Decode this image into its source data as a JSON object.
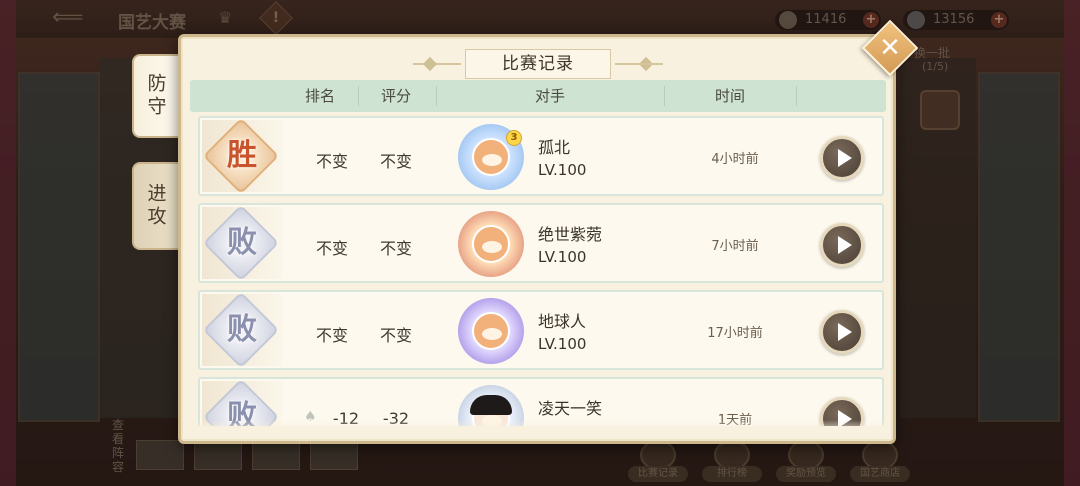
{
  "background": {
    "title": "国艺大赛",
    "resources": [
      {
        "value": "11416",
        "icon": "flower-icon"
      },
      {
        "value": "13156",
        "icon": "coin-icon"
      }
    ],
    "hint_text": "换一批",
    "hint_sub": "(1/5)",
    "side_text": "查看阵容",
    "bottom_buttons": [
      {
        "label": "比赛记录",
        "icon": "record-icon"
      },
      {
        "label": "排行榜",
        "icon": "ranking-icon"
      },
      {
        "label": "奖励预览",
        "icon": "reward-icon"
      },
      {
        "label": "国艺商店",
        "icon": "shop-icon"
      }
    ]
  },
  "tabs": [
    {
      "label": "防守",
      "active": true
    },
    {
      "label": "进攻",
      "active": false
    }
  ],
  "dialog": {
    "title": "比赛记录",
    "columns": [
      "排名",
      "评分",
      "对手",
      "时间"
    ]
  },
  "records": [
    {
      "result": "胜",
      "result_type": "win",
      "rank": "不变",
      "score": "不变",
      "opponent": "孤北",
      "level": "LV.100",
      "time": "4小时前",
      "avatar": "cat-avatar-blue"
    },
    {
      "result": "败",
      "result_type": "lose",
      "rank": "不变",
      "score": "不变",
      "opponent": "绝世紫菀",
      "level": "LV.100",
      "time": "7小时前",
      "avatar": "cat-avatar-red"
    },
    {
      "result": "败",
      "result_type": "lose",
      "rank": "不变",
      "score": "不变",
      "opponent": "地球人",
      "level": "LV.100",
      "time": "17小时前",
      "avatar": "cat-avatar-purple"
    },
    {
      "result": "败",
      "result_type": "lose",
      "rank": "-12",
      "score": "-32",
      "opponent": "凌天一笑",
      "level": "",
      "time": "1天前",
      "avatar": "person-avatar"
    }
  ],
  "colors": {
    "win": "#c8542e",
    "lose": "#8a90ad",
    "header_bg": "#cfe3d3",
    "dialog_bg": "#f8f1df"
  }
}
